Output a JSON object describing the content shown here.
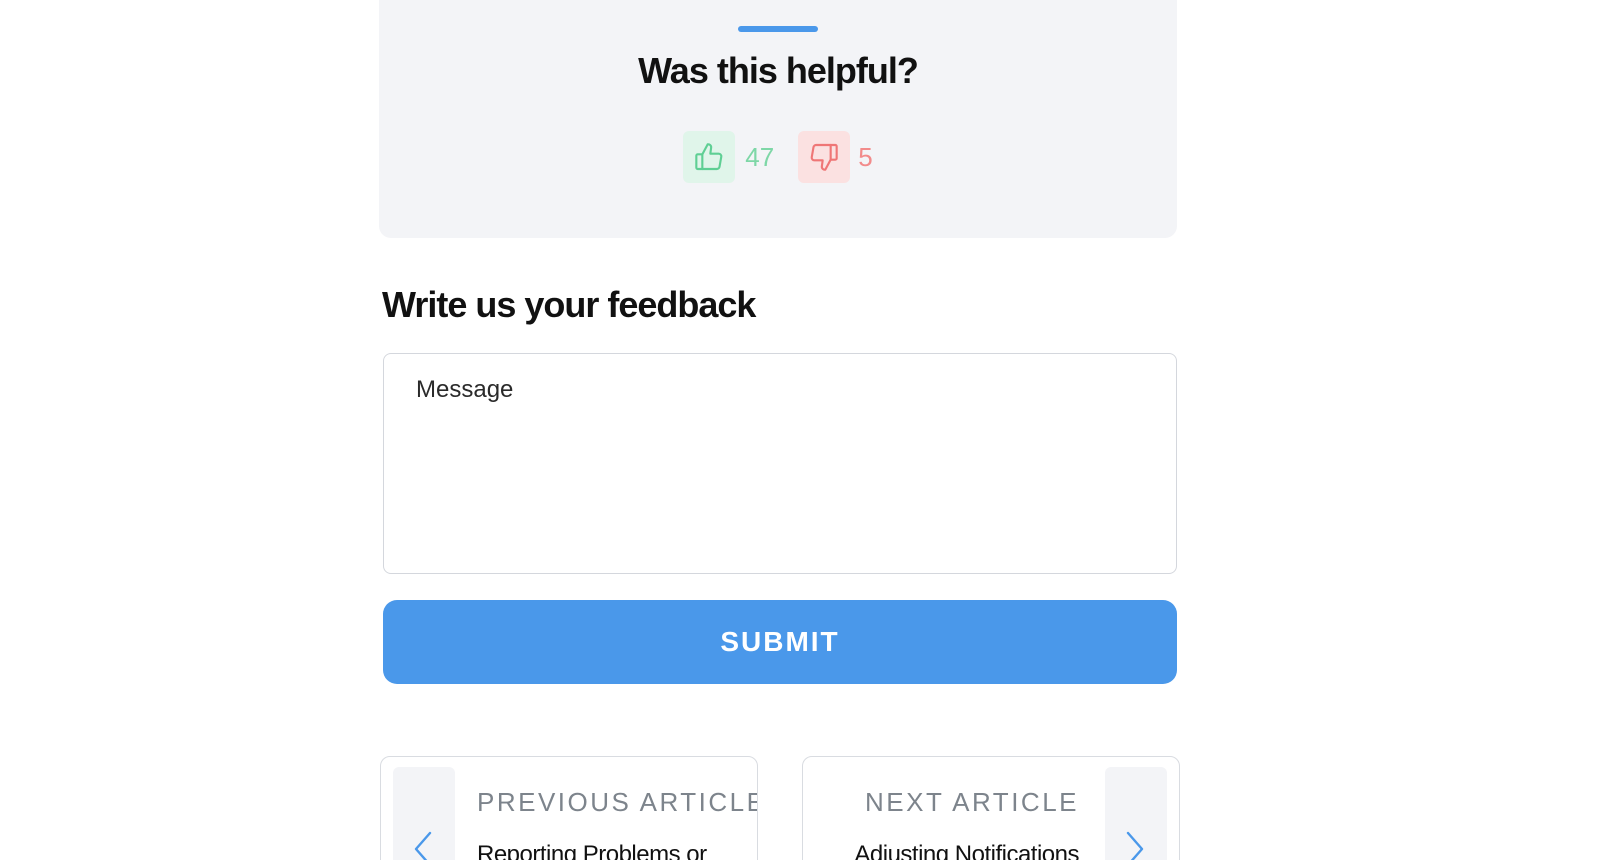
{
  "helpful": {
    "title": "Was this helpful?",
    "upvotes": "47",
    "downvotes": "5",
    "up_icon": "thumbs-up-icon",
    "down_icon": "thumbs-down-icon"
  },
  "feedback": {
    "title": "Write us your feedback",
    "message_placeholder": "Message",
    "message_value": "",
    "submit_label": "SUBMIT"
  },
  "navigation": {
    "previous": {
      "kicker": "PREVIOUS ARTICLE",
      "title": "Reporting Problems or",
      "icon": "chevron-left-icon"
    },
    "next": {
      "kicker": "NEXT ARTICLE",
      "title": "Adjusting Notifications",
      "icon": "chevron-right-icon"
    }
  },
  "colors": {
    "accent": "#4a98ea",
    "card_background": "#f3f4f7",
    "upvote": "#7ed7a7",
    "downvote": "#f28b8b"
  }
}
